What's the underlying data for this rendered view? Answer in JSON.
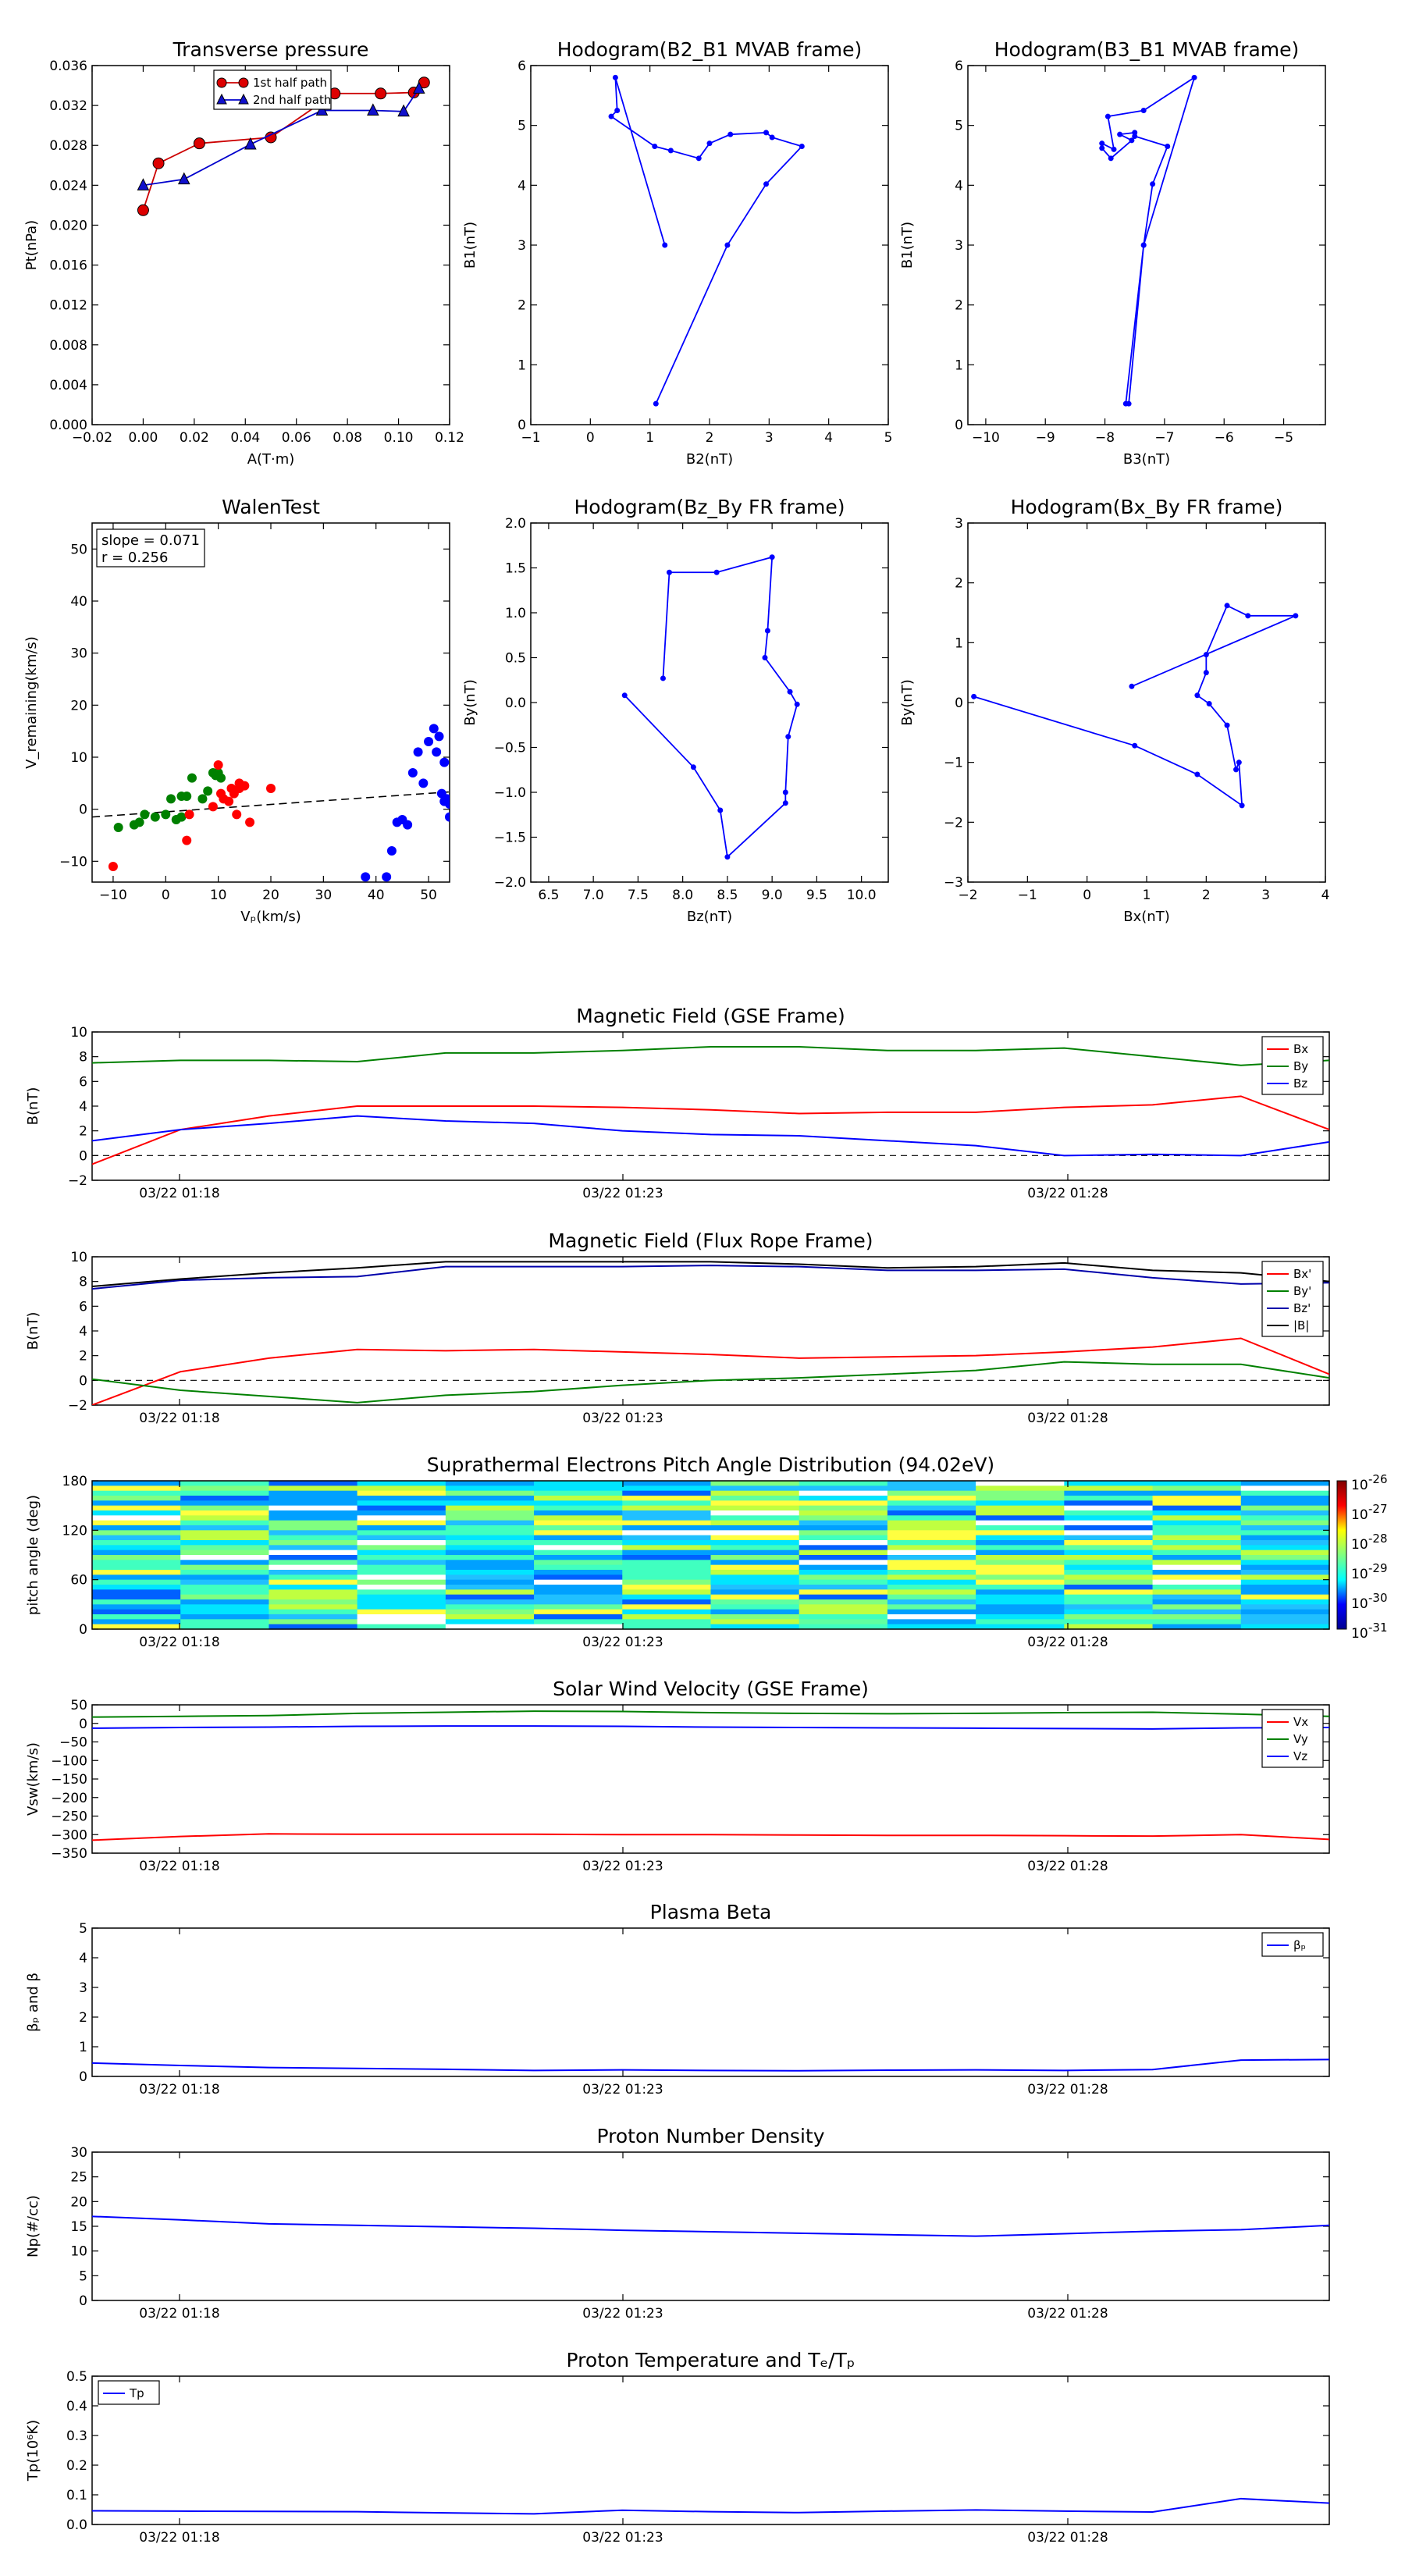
{
  "chart_data": [
    {
      "id": "tp",
      "type": "line",
      "title": "Transverse pressure",
      "xlabel": "A(T·m)",
      "ylabel": "Pt(nPa)",
      "xlim": [
        -0.02,
        0.12
      ],
      "ylim": [
        0,
        0.036
      ],
      "xticks": [
        -0.02,
        0,
        0.02,
        0.04,
        0.06,
        0.08,
        0.1,
        0.12
      ],
      "xtick_labels": [
        "−0.02",
        "0.00",
        "0.02",
        "0.04",
        "0.06",
        "0.08",
        "0.10",
        "0.12"
      ],
      "yticks": [
        0,
        0.004,
        0.008,
        0.012,
        0.016,
        0.02,
        0.024,
        0.028,
        0.032,
        0.036
      ],
      "ytick_labels": [
        "0.000",
        "0.004",
        "0.008",
        "0.012",
        "0.016",
        "0.020",
        "0.024",
        "0.028",
        "0.032",
        "0.036"
      ],
      "legend": "top-center",
      "series": [
        {
          "name": "1st half path",
          "color": "#cc0000",
          "marker": "circle",
          "x": [
            0.0,
            0.006,
            0.022,
            0.05,
            0.075,
            0.093,
            0.106,
            0.11
          ],
          "y": [
            0.0215,
            0.0262,
            0.0282,
            0.0288,
            0.0332,
            0.0332,
            0.0333,
            0.0343
          ]
        },
        {
          "name": "2nd half path",
          "color": "#0000cc",
          "marker": "triangle",
          "x": [
            0.0,
            0.016,
            0.042,
            0.07,
            0.09,
            0.102,
            0.108
          ],
          "y": [
            0.024,
            0.0246,
            0.0281,
            0.0315,
            0.0315,
            0.0314,
            0.0337
          ]
        }
      ]
    },
    {
      "id": "h1",
      "type": "line",
      "title": "Hodogram(B2_B1 MVAB frame)",
      "xlabel": "B2(nT)",
      "ylabel": "B1(nT)",
      "xlim": [
        -1,
        5
      ],
      "ylim": [
        0,
        6
      ],
      "xticks": [
        -1,
        0,
        1,
        2,
        3,
        4,
        5
      ],
      "xtick_labels": [
        "−1",
        "0",
        "1",
        "2",
        "3",
        "4",
        "5"
      ],
      "yticks": [
        0,
        1,
        2,
        3,
        4,
        5,
        6
      ],
      "ytick_labels": [
        "0",
        "1",
        "2",
        "3",
        "4",
        "5",
        "6"
      ],
      "series": [
        {
          "color": "#0000ff",
          "marker": "dot",
          "x": [
            1.1,
            2.3,
            2.95,
            3.55,
            3.05,
            2.95,
            2.35,
            2.0,
            1.82,
            1.35,
            1.08,
            0.35,
            0.45,
            0.42,
            1.25
          ],
          "y": [
            0.35,
            3.0,
            4.02,
            4.65,
            4.8,
            4.88,
            4.85,
            4.7,
            4.45,
            4.58,
            4.65,
            5.15,
            5.25,
            5.8,
            3.0
          ]
        }
      ]
    },
    {
      "id": "h2",
      "type": "line",
      "title": "Hodogram(B3_B1 MVAB frame)",
      "xlabel": "B3(nT)",
      "ylabel": "B1(nT)",
      "xlim": [
        -10.3,
        -4.3
      ],
      "ylim": [
        0,
        6
      ],
      "xticks": [
        -10,
        -9,
        -8,
        -7,
        -6,
        -5
      ],
      "xtick_labels": [
        "−10",
        "−9",
        "−8",
        "−7",
        "−6",
        "−5"
      ],
      "yticks": [
        0,
        1,
        2,
        3,
        4,
        5,
        6
      ],
      "ytick_labels": [
        "0",
        "1",
        "2",
        "3",
        "4",
        "5",
        "6"
      ],
      "series": [
        {
          "color": "#0000ff",
          "marker": "dot",
          "x": [
            -7.6,
            -7.35,
            -7.2,
            -6.95,
            -7.5,
            -7.5,
            -7.75,
            -7.55,
            -7.9,
            -8.05,
            -8.05,
            -7.85,
            -7.95,
            -7.35,
            -6.5,
            -7.35,
            -7.65
          ],
          "y": [
            0.35,
            3.0,
            4.02,
            4.65,
            4.82,
            4.88,
            4.85,
            4.75,
            4.45,
            4.62,
            4.7,
            4.6,
            5.15,
            5.25,
            5.8,
            3.0,
            0.35
          ]
        }
      ]
    },
    {
      "id": "walen",
      "type": "scatter",
      "title": "WalenTest",
      "xlabel": "Vₚ(km/s)",
      "ylabel": "V_remaining(km/s)",
      "xlim": [
        -14,
        54
      ],
      "ylim": [
        -14,
        55
      ],
      "xticks": [
        -10,
        0,
        10,
        20,
        30,
        40,
        50
      ],
      "xtick_labels": [
        "−10",
        "0",
        "10",
        "20",
        "30",
        "40",
        "50"
      ],
      "yticks": [
        -10,
        0,
        10,
        20,
        30,
        40,
        50
      ],
      "ytick_labels": [
        "−10",
        "0",
        "10",
        "20",
        "30",
        "40",
        "50"
      ],
      "annotation": [
        "slope = 0.071",
        "r = 0.256"
      ],
      "fit": {
        "slope": 0.071,
        "intercept": -0.5
      },
      "series": [
        {
          "color": "#008000",
          "x": [
            -9,
            -6,
            -5,
            -4,
            -2,
            0,
            1,
            2,
            3,
            4,
            5,
            7,
            8,
            9,
            9.5,
            10,
            10.5,
            3
          ],
          "y": [
            -3.5,
            -3,
            -2.5,
            -1,
            -1.5,
            -1,
            2,
            -2,
            -1.5,
            2.5,
            6,
            2,
            3.5,
            7,
            6.5,
            7,
            6,
            2.5
          ]
        },
        {
          "color": "#ff0000",
          "x": [
            -10,
            4,
            4.5,
            9,
            10,
            10.5,
            11,
            12,
            12.5,
            13,
            13.5,
            14,
            14,
            15,
            16,
            20
          ],
          "y": [
            -11,
            -6,
            -1,
            0.5,
            8.5,
            3,
            2,
            1.5,
            4,
            3,
            -1,
            5,
            4,
            4.5,
            -2.5,
            4
          ]
        },
        {
          "color": "#0000ff",
          "x": [
            38,
            42,
            43,
            44,
            45,
            46,
            47,
            48,
            49,
            50,
            51,
            51.5,
            52,
            52.5,
            53,
            53.5,
            54,
            54,
            53
          ],
          "y": [
            -13,
            -13,
            -8,
            -2.5,
            -2,
            -3,
            7,
            11,
            5,
            13,
            15.5,
            11,
            14,
            3,
            1.5,
            2,
            1,
            -1.5,
            9
          ]
        }
      ]
    },
    {
      "id": "h3",
      "type": "line",
      "title": "Hodogram(Bz_By FR frame)",
      "xlabel": "Bz(nT)",
      "ylabel": "By(nT)",
      "xlim": [
        6.3,
        10.3
      ],
      "ylim": [
        -2,
        2
      ],
      "xticks": [
        6.5,
        7,
        7.5,
        8,
        8.5,
        9,
        9.5,
        10
      ],
      "xtick_labels": [
        "6.5",
        "7.0",
        "7.5",
        "8.0",
        "8.5",
        "9.0",
        "9.5",
        "10.0"
      ],
      "yticks": [
        -2,
        -1.5,
        -1,
        -0.5,
        0,
        0.5,
        1,
        1.5,
        2
      ],
      "ytick_labels": [
        "−2.0",
        "−1.5",
        "−1.0",
        "−0.5",
        "0.0",
        "0.5",
        "1.0",
        "1.5",
        "2.0"
      ],
      "series": [
        {
          "color": "#0000ff",
          "marker": "dot",
          "x": [
            7.35,
            8.12,
            8.42,
            8.5,
            9.15,
            9.15,
            9.18,
            9.28,
            9.2,
            8.92,
            8.95,
            9.0,
            8.38,
            7.85,
            7.78
          ],
          "y": [
            0.08,
            -0.72,
            -1.2,
            -1.72,
            -1.12,
            -1.0,
            -0.38,
            -0.02,
            0.12,
            0.5,
            0.8,
            1.62,
            1.45,
            1.45,
            0.27
          ]
        }
      ]
    },
    {
      "id": "h4",
      "type": "line",
      "title": "Hodogram(Bx_By FR frame)",
      "xlabel": "Bx(nT)",
      "ylabel": "By(nT)",
      "xlim": [
        -2,
        4
      ],
      "ylim": [
        -3,
        3
      ],
      "xticks": [
        -2,
        -1,
        0,
        1,
        2,
        3,
        4
      ],
      "xtick_labels": [
        "−2",
        "−1",
        "0",
        "1",
        "2",
        "3",
        "4"
      ],
      "yticks": [
        -3,
        -2,
        -1,
        0,
        1,
        2,
        3
      ],
      "ytick_labels": [
        "−3",
        "−2",
        "−1",
        "0",
        "1",
        "2",
        "3"
      ],
      "series": [
        {
          "color": "#0000ff",
          "marker": "dot",
          "x": [
            -1.9,
            0.8,
            1.85,
            2.6,
            2.55,
            2.5,
            2.35,
            2.05,
            1.85,
            2.0,
            2.0,
            2.35,
            2.7,
            3.5,
            0.75
          ],
          "y": [
            0.1,
            -0.72,
            -1.2,
            -1.72,
            -1.0,
            -1.12,
            -0.38,
            -0.02,
            0.12,
            0.5,
            0.8,
            1.62,
            1.45,
            1.45,
            0.27
          ]
        }
      ]
    },
    {
      "id": "mf_gse",
      "type": "line",
      "title": "Magnetic Field (GSE Frame)",
      "ylabel": "B(nT)",
      "ylim": [
        -2,
        10
      ],
      "yticks": [
        -2,
        0,
        2,
        4,
        6,
        8,
        10
      ],
      "ytick_labels": [
        "−2",
        "0",
        "2",
        "4",
        "6",
        "8",
        "10"
      ],
      "zero_line": true,
      "legend": "top-right",
      "series": [
        {
          "name": "Bx",
          "color": "#ff0000",
          "values": [
            -0.7,
            2.1,
            3.2,
            4.0,
            4.0,
            4.0,
            3.9,
            3.7,
            3.4,
            3.5,
            3.5,
            3.9,
            4.1,
            4.8,
            2.1
          ]
        },
        {
          "name": "By",
          "color": "#008000",
          "values": [
            7.5,
            7.7,
            7.7,
            7.6,
            8.3,
            8.3,
            8.5,
            8.8,
            8.8,
            8.5,
            8.5,
            8.7,
            8.0,
            7.3,
            7.7
          ]
        },
        {
          "name": "Bz",
          "color": "#0000ff",
          "values": [
            1.2,
            2.1,
            2.6,
            3.2,
            2.8,
            2.6,
            2.0,
            1.7,
            1.6,
            1.2,
            0.8,
            0.0,
            0.1,
            0.0,
            1.1
          ]
        }
      ]
    },
    {
      "id": "mf_fr",
      "type": "line",
      "title": "Magnetic Field (Flux Rope Frame)",
      "ylabel": "B(nT)",
      "ylim": [
        -2,
        10
      ],
      "yticks": [
        -2,
        0,
        2,
        4,
        6,
        8,
        10
      ],
      "ytick_labels": [
        "−2",
        "0",
        "2",
        "4",
        "6",
        "8",
        "10"
      ],
      "zero_line": true,
      "legend": "top-right",
      "series": [
        {
          "name": "Bx'",
          "color": "#ff0000",
          "values": [
            -2.0,
            0.7,
            1.8,
            2.5,
            2.4,
            2.5,
            2.3,
            2.1,
            1.8,
            1.9,
            2.0,
            2.3,
            2.7,
            3.4,
            0.5
          ]
        },
        {
          "name": "By'",
          "color": "#008000",
          "values": [
            0.1,
            -0.8,
            -1.3,
            -1.8,
            -1.2,
            -0.9,
            -0.4,
            0.0,
            0.2,
            0.5,
            0.8,
            1.5,
            1.3,
            1.3,
            0.2
          ]
        },
        {
          "name": "Bz'",
          "color": "#0000aa",
          "values": [
            7.4,
            8.1,
            8.3,
            8.4,
            9.2,
            9.2,
            9.2,
            9.3,
            9.2,
            8.9,
            8.9,
            9.0,
            8.3,
            7.8,
            7.9
          ]
        },
        {
          "name": "|B|",
          "color": "#000000",
          "values": [
            7.6,
            8.2,
            8.7,
            9.1,
            9.6,
            9.6,
            9.6,
            9.6,
            9.4,
            9.1,
            9.2,
            9.5,
            8.9,
            8.7,
            8.0
          ]
        }
      ]
    },
    {
      "id": "pad",
      "type": "heatmap",
      "title": "Suprathermal Electrons Pitch Angle Distribution (94.02eV)",
      "ylabel": "pitch angle (deg)",
      "ylim": [
        0,
        180
      ],
      "yticks": [
        0,
        60,
        120,
        180
      ],
      "ytick_labels": [
        "0",
        "60",
        "120",
        "180"
      ],
      "colorbar_labels": [
        "10",
        "10",
        "10",
        "10",
        "10",
        "10"
      ],
      "colorbar_exponents": [
        "-26",
        "-27",
        "-28",
        "-29",
        "-30",
        "-31"
      ]
    },
    {
      "id": "vsw",
      "type": "line",
      "title": "Solar Wind Velocity (GSE Frame)",
      "ylabel": "Vsw(km/s)",
      "ylim": [
        -350,
        50
      ],
      "yticks": [
        -350,
        -300,
        -250,
        -200,
        -150,
        -100,
        -50,
        0,
        50
      ],
      "ytick_labels": [
        "−350",
        "−300",
        "−250",
        "−200",
        "−150",
        "−100",
        "−50",
        "0",
        "50"
      ],
      "legend": "top-right",
      "series": [
        {
          "name": "Vx",
          "color": "#ff0000",
          "values": [
            -315,
            -305,
            -298,
            -299,
            -299,
            -299,
            -300,
            -300,
            -301,
            -302,
            -302,
            -303,
            -304,
            -300,
            -313
          ]
        },
        {
          "name": "Vy",
          "color": "#008000",
          "values": [
            17,
            19,
            21,
            27,
            30,
            33,
            32,
            29,
            27,
            26,
            27,
            29,
            30,
            25,
            19
          ]
        },
        {
          "name": "Vz",
          "color": "#0000ff",
          "values": [
            -13,
            -11,
            -10,
            -8,
            -7,
            -7,
            -8,
            -10,
            -11,
            -12,
            -13,
            -14,
            -15,
            -12,
            -11
          ]
        }
      ]
    },
    {
      "id": "beta",
      "type": "line",
      "title": "Plasma Beta",
      "ylabel": "βₚ and β",
      "ylim": [
        0,
        5
      ],
      "yticks": [
        0,
        1,
        2,
        3,
        4,
        5
      ],
      "ytick_labels": [
        "0",
        "1",
        "2",
        "3",
        "4",
        "5"
      ],
      "legend": "top-right",
      "series": [
        {
          "name": "βₚ",
          "color": "#0000ff",
          "values": [
            0.45,
            0.37,
            0.3,
            0.27,
            0.24,
            0.2,
            0.22,
            0.2,
            0.19,
            0.21,
            0.22,
            0.2,
            0.23,
            0.55,
            0.57
          ]
        }
      ]
    },
    {
      "id": "np",
      "type": "line",
      "title": "Proton Number Density",
      "ylabel": "Np(#/cc)",
      "ylim": [
        0,
        30
      ],
      "yticks": [
        0,
        5,
        10,
        15,
        20,
        25,
        30
      ],
      "ytick_labels": [
        "0",
        "5",
        "10",
        "15",
        "20",
        "25",
        "30"
      ],
      "series": [
        {
          "color": "#0000ff",
          "values": [
            17,
            16.3,
            15.5,
            15.2,
            14.9,
            14.6,
            14.2,
            13.9,
            13.6,
            13.3,
            13.0,
            13.5,
            14.0,
            14.3,
            15.2
          ]
        }
      ]
    },
    {
      "id": "tp2",
      "type": "line",
      "title": "Proton Temperature and Tₑ/Tₚ",
      "ylabel": "Tp(10⁶K)",
      "ylim": [
        0,
        0.5
      ],
      "yticks": [
        0,
        0.1,
        0.2,
        0.3,
        0.4,
        0.5
      ],
      "ytick_labels": [
        "0.0",
        "0.1",
        "0.2",
        "0.3",
        "0.4",
        "0.5"
      ],
      "legend": "top-left",
      "series": [
        {
          "name": "Tp",
          "color": "#0000ff",
          "values": [
            0.046,
            0.045,
            0.044,
            0.043,
            0.039,
            0.036,
            0.048,
            0.043,
            0.04,
            0.045,
            0.049,
            0.045,
            0.042,
            0.087,
            0.072
          ]
        }
      ]
    }
  ],
  "time_axis": {
    "n_points": 15,
    "tick_index": [
      1,
      6,
      11
    ],
    "tick_labels": [
      "03/22 01:18",
      "03/22 01:23",
      "03/22 01:28"
    ]
  }
}
